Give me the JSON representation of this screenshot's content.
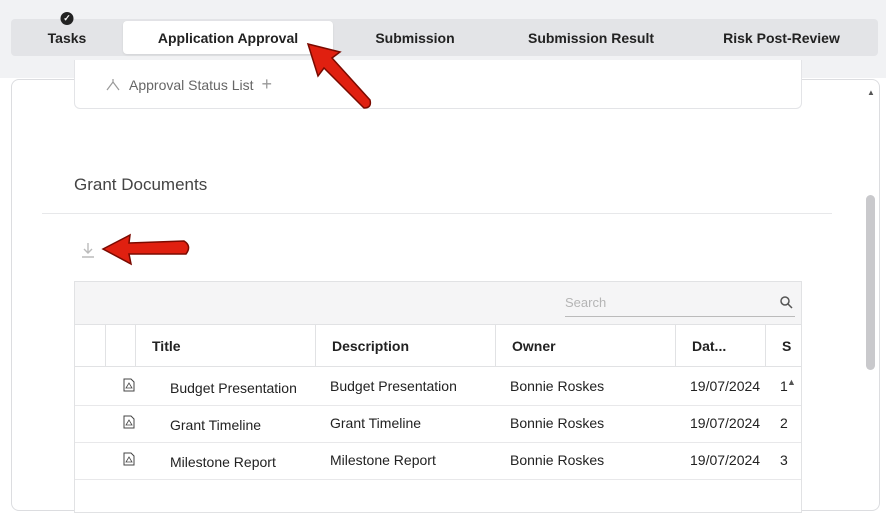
{
  "tabs": [
    {
      "label": "Tasks",
      "active": false,
      "completed": true
    },
    {
      "label": "Application Approval",
      "active": true,
      "completed": false
    },
    {
      "label": "Submission",
      "active": false,
      "completed": false
    },
    {
      "label": "Submission Result",
      "active": false,
      "completed": false
    },
    {
      "label": "Risk Post-Review",
      "active": false,
      "completed": false
    }
  ],
  "approval_status": {
    "label": "Approval Status List",
    "add_icon": "plus-icon"
  },
  "section": {
    "title": "Grant Documents",
    "download_icon": "download-icon"
  },
  "grid": {
    "search_placeholder": "Search",
    "columns": [
      "Title",
      "Description",
      "Owner",
      "Dat...",
      "S"
    ],
    "rows": [
      {
        "title": "Budget Presentation",
        "description": "Budget Presentation",
        "owner": "Bonnie Roskes",
        "date": "19/07/2024",
        "s": "1",
        "icon": "pdf-file-icon"
      },
      {
        "title": "Grant Timeline",
        "description": "Grant Timeline",
        "owner": "Bonnie Roskes",
        "date": "19/07/2024",
        "s": "2",
        "icon": "pdf-file-icon"
      },
      {
        "title": "Milestone Report",
        "description": "Milestone Report",
        "owner": "Bonnie Roskes",
        "date": "19/07/2024",
        "s": "3",
        "icon": "pdf-file-icon"
      }
    ]
  },
  "colors": {
    "annotation_arrow": "#e02010",
    "active_tab": "#ffffff",
    "tab_bar": "#e3e4e7"
  }
}
